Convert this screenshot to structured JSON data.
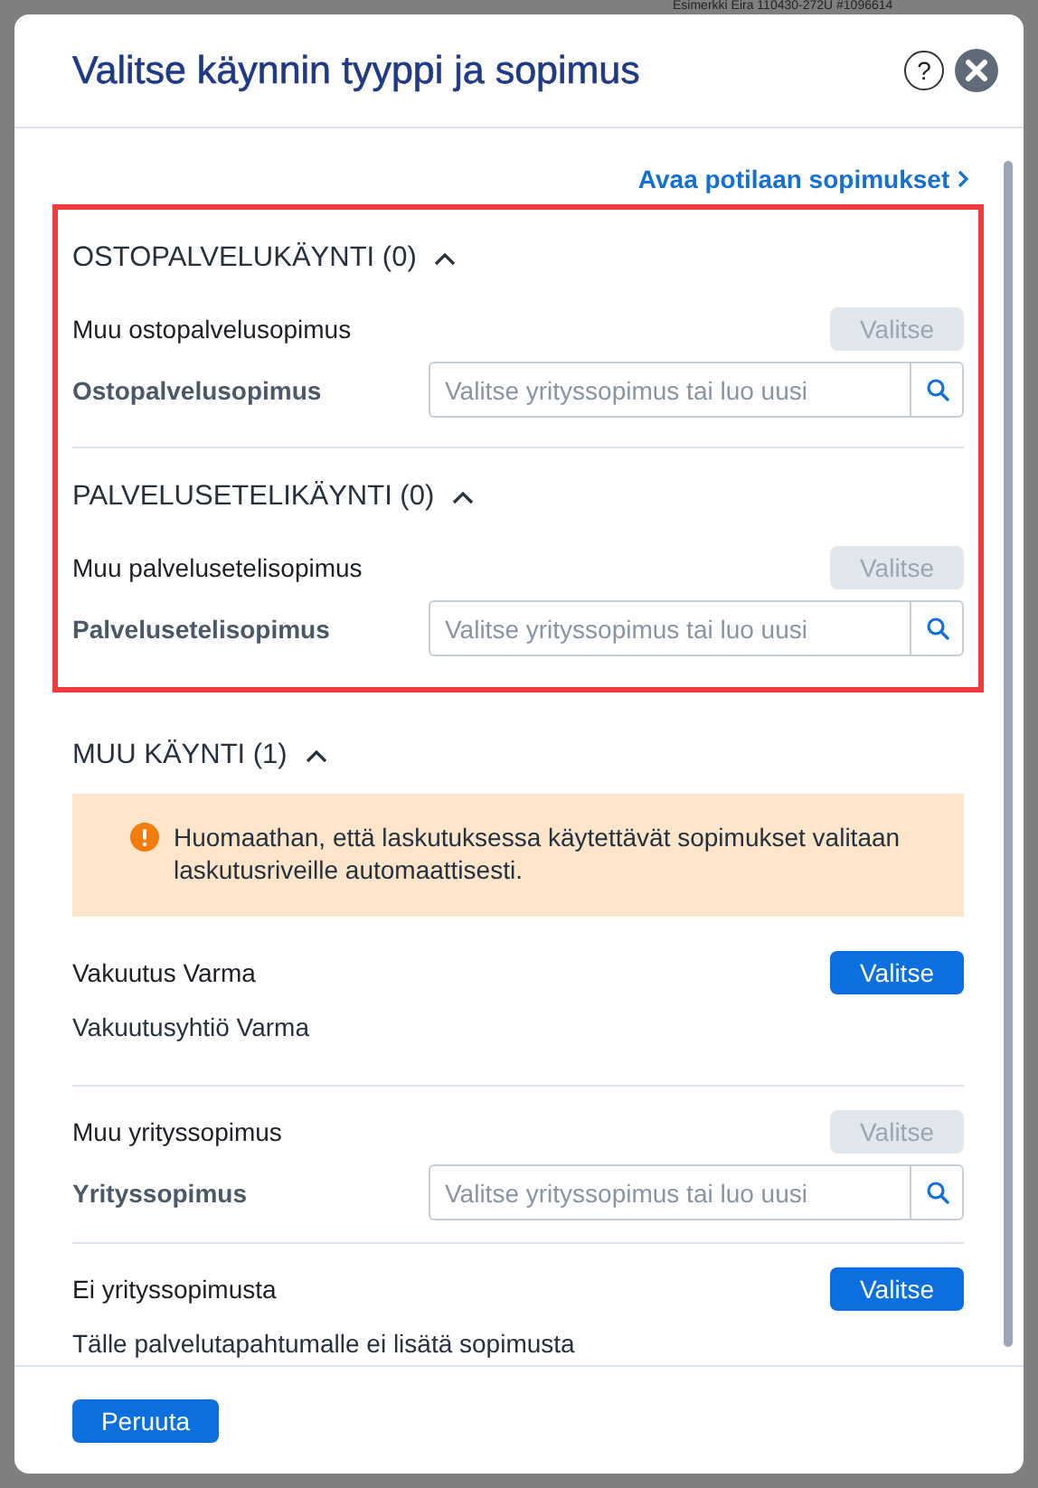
{
  "background": {
    "header_text": "Esimerkki Eira 110430-272U #1096614"
  },
  "dialog": {
    "title": "Valitse käynnin tyyppi ja sopimus",
    "help_icon": "?",
    "link": "Avaa potilaan sopimukset",
    "groups": [
      {
        "highlighted": true,
        "sections": [
          {
            "title": "OSTOPALVELUKÄYNTI (0)",
            "expanded": true,
            "items": [
              {
                "kind": "option",
                "label": "Muu ostopalvelusopimus",
                "button": {
                  "label": "Valitse",
                  "disabled": true
                },
                "field": {
                  "label": "Ostopalvelusopimus",
                  "placeholder": "Valitse yrityssopimus tai luo uusi"
                }
              }
            ]
          },
          {
            "title": "PALVELUSETELIKÄYNTI (0)",
            "expanded": true,
            "items": [
              {
                "kind": "option",
                "label": "Muu palvelusetelisopimus",
                "button": {
                  "label": "Valitse",
                  "disabled": true
                },
                "field": {
                  "label": "Palvelusetelisopimus",
                  "placeholder": "Valitse yrityssopimus tai luo uusi"
                }
              }
            ]
          }
        ]
      },
      {
        "highlighted": false,
        "sections": [
          {
            "title": "MUU KÄYNTI (1)",
            "expanded": true,
            "items": [
              {
                "kind": "notice",
                "text": "Huomaathan, että laskutuksessa käytettävät sopimukset valitaan laskutusriveille automaattisesti."
              },
              {
                "kind": "option",
                "label": "Vakuutus Varma",
                "button": {
                  "label": "Valitse",
                  "disabled": false
                },
                "description": "Vakuutusyhtiö Varma"
              },
              {
                "kind": "option",
                "label": "Muu yrityssopimus",
                "button": {
                  "label": "Valitse",
                  "disabled": true
                },
                "field": {
                  "label": "Yrityssopimus",
                  "placeholder": "Valitse yrityssopimus tai luo uusi"
                }
              },
              {
                "kind": "option",
                "label": "Ei yrityssopimusta",
                "button": {
                  "label": "Valitse",
                  "disabled": false
                },
                "description": "Tälle palvelutapahtumalle ei lisätä sopimusta"
              }
            ]
          }
        ]
      }
    ],
    "cancel_button": "Peruuta"
  }
}
